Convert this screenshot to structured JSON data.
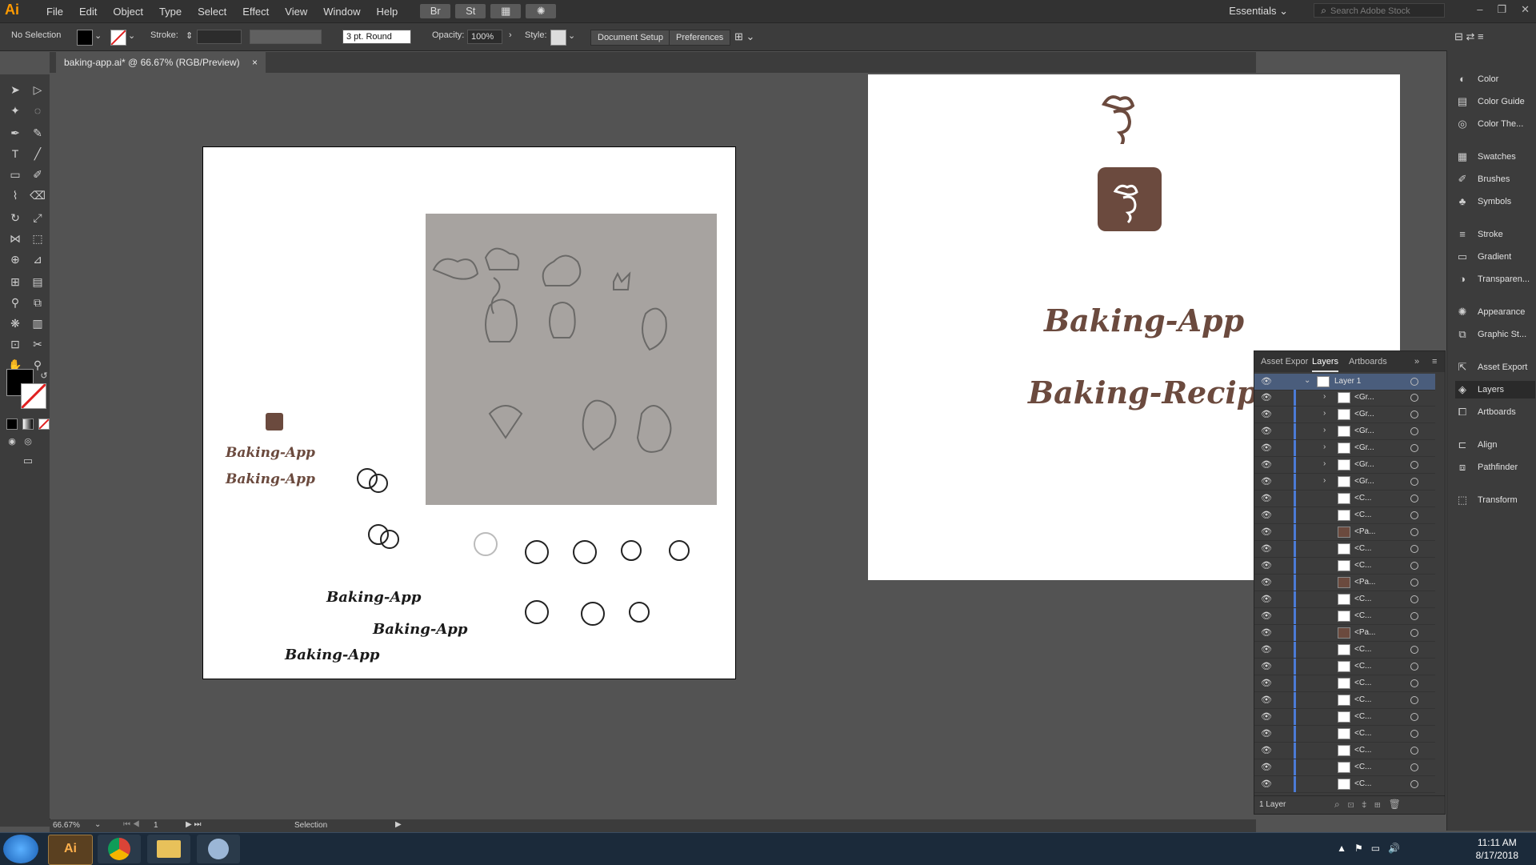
{
  "app": {
    "logo": "Ai",
    "menus": [
      "File",
      "Edit",
      "Object",
      "Type",
      "Select",
      "Effect",
      "View",
      "Window",
      "Help"
    ],
    "bridge_labels": [
      "Br",
      "St"
    ],
    "workspace": "Essentials",
    "search_placeholder": "Search Adobe Stock"
  },
  "control_bar": {
    "selection": "No Selection",
    "stroke_label": "Stroke:",
    "brush": "3 pt. Round",
    "opacity_label": "Opacity:",
    "opacity_value": "100%",
    "style_label": "Style:",
    "document_setup": "Document Setup",
    "preferences": "Preferences"
  },
  "document": {
    "tab_title": "baking-app.ai* @ 66.67% (RGB/Preview)",
    "close": "×"
  },
  "artboard1": {
    "texts": [
      "Baking-App",
      "Baking-App",
      "Baking-App",
      "Baking-App",
      "Baking-App"
    ]
  },
  "artboard2": {
    "title1": "Baking-App",
    "title2": "Baking-Recipes",
    "brand_color": "#6b4a3e"
  },
  "dock": {
    "items": [
      "Color",
      "Color Guide",
      "Color The...",
      "Swatches",
      "Brushes",
      "Symbols",
      "Stroke",
      "Gradient",
      "Transparen...",
      "Appearance",
      "Graphic St...",
      "Asset Export",
      "Layers",
      "Artboards",
      "Align",
      "Pathfinder",
      "Transform"
    ]
  },
  "layers_panel": {
    "tabs": [
      "Asset Expor",
      "Layers",
      "Artboards"
    ],
    "layer_name": "Layer 1",
    "rows": [
      "<Gr...",
      "<Gr...",
      "<Gr...",
      "<Gr...",
      "<Gr...",
      "<Gr...",
      "<C...",
      "<C...",
      "<Pa...",
      "<C...",
      "<C...",
      "<Pa...",
      "<C...",
      "<C...",
      "<Pa...",
      "<C...",
      "<C...",
      "<C...",
      "<C...",
      "<C...",
      "<C...",
      "<C...",
      "<C...",
      "<C..."
    ],
    "footer": "1 Layer"
  },
  "status": {
    "zoom": "66.67%",
    "artboard_num": "1",
    "tool": "Selection"
  },
  "taskbar": {
    "time": "11:11 AM",
    "date": "8/17/2018"
  }
}
